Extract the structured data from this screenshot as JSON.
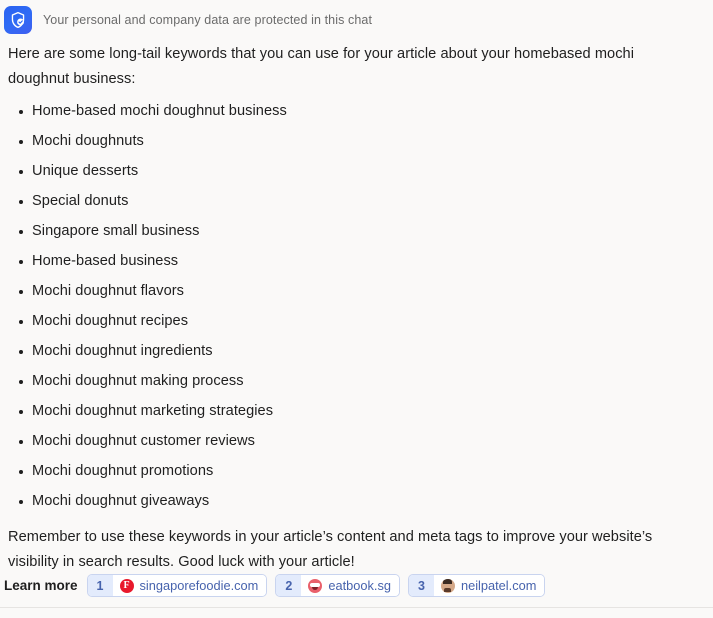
{
  "privacy_banner": {
    "icon": "shield-check-icon",
    "text": "Your personal and company data are protected in this chat",
    "icon_bg_color": "#2f6bf5",
    "text_color": "#6b6b6b"
  },
  "message": {
    "intro_paragraph": "Here are some long-tail keywords that you can use for your article about your homebased mochi doughnut business:",
    "keywords": [
      "Home-based mochi doughnut business",
      "Mochi doughnuts",
      "Unique desserts",
      "Special donuts",
      "Singapore small business",
      "Home-based business",
      "Mochi doughnut flavors",
      "Mochi doughnut recipes",
      "Mochi doughnut ingredients",
      "Mochi doughnut making process",
      "Mochi doughnut marketing strategies",
      "Mochi doughnut customer reviews",
      "Mochi doughnut promotions",
      "Mochi doughnut giveaways"
    ],
    "outro_paragraph": "Remember to use these keywords in your article’s content and meta tags to improve your website’s visibility in search results. Good luck with your article!"
  },
  "learn_more": {
    "label": "Learn more",
    "accent_color": "#4763ad",
    "chip_index_bg": "#e3ebfc",
    "citations": [
      {
        "index": "1",
        "domain": "singaporefoodie.com",
        "favicon": "singaporefoodie-favicon",
        "favicon_letter": "F",
        "favicon_color": "#e8192c"
      },
      {
        "index": "2",
        "domain": "eatbook.sg",
        "favicon": "eatbook-favicon",
        "favicon_letter": "",
        "favicon_color": "#e9606b"
      },
      {
        "index": "3",
        "domain": "neilpatel.com",
        "favicon": "neilpatel-avatar-favicon",
        "favicon_letter": "",
        "favicon_color": "#d4a888"
      }
    ]
  }
}
